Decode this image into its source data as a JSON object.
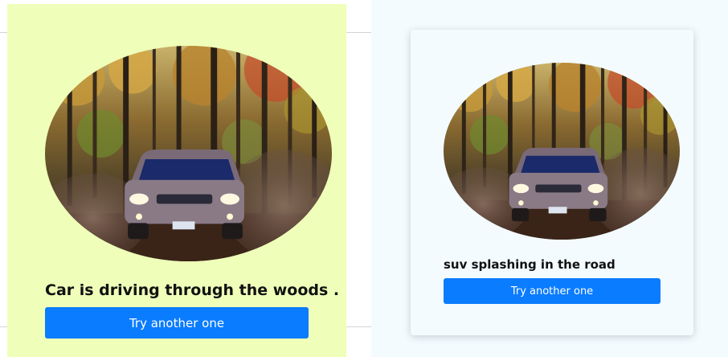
{
  "left_panel": {
    "image_alt_icon": "photo-suv-forest",
    "caption": "Car is driving through the woods .",
    "button_label": "Try another one",
    "background_color": "#efffb9"
  },
  "right_panel": {
    "image_alt_icon": "photo-suv-forest",
    "caption": "suv splashing in the road",
    "button_label": "Try another one",
    "background_color": "#f3fbff"
  },
  "colors": {
    "button": "#0a7cff",
    "button_text": "#ffffff"
  }
}
